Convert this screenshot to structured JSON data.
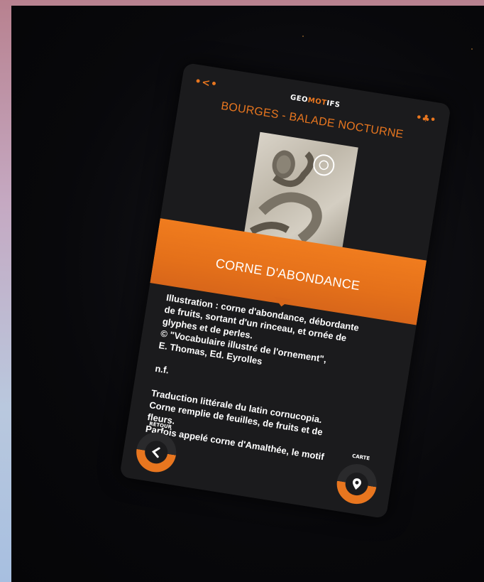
{
  "app": {
    "logo_pre": "GEO",
    "logo_mid": "MOT",
    "logo_post": "IFS"
  },
  "header": {
    "back_glyph": "•<•",
    "page_title": "BOURGES - BALADE NOCTURNE",
    "bell_glyph": "•♣•"
  },
  "item": {
    "title": "CORNE D'ABONDANCE",
    "illustration_lines": [
      "Illustration : corne d'abondance, débordante",
      "de fruits, sortant d'un rinceau, et ornée de",
      "glyphes et de perles.",
      "© \"Vocabulaire illustré de l'ornement\",",
      "E. Thomas, Ed. Eyrolles"
    ],
    "pos": "n.f.",
    "definition_lines": [
      "Traduction littérale du latin cornucopia.",
      "Corne remplie de feuilles, de fruits et de",
      "fleurs.",
      "Parfois appelé corne d'Amalthée, le motif"
    ]
  },
  "nav": {
    "retour_label": "RETOUR",
    "carte_label": "CARTE"
  },
  "icons": {
    "back": "chevron-left-icon",
    "map": "map-pin-icon",
    "bell": "bell-icon",
    "zoom": "zoom-icon"
  },
  "colors": {
    "accent": "#e8761f",
    "panel": "#1b1b1d",
    "text": "#ffffff"
  }
}
